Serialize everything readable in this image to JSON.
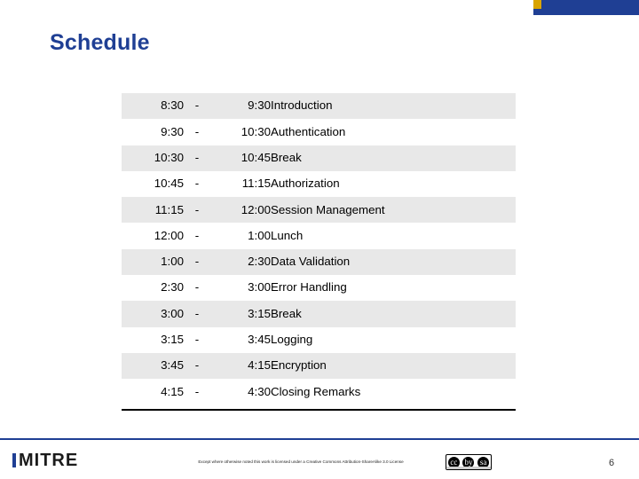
{
  "slide": {
    "title": "Schedule",
    "page_number": "6"
  },
  "decor": {
    "blue_bar_color": "#1f3f94",
    "gold_bar_color": "#d9a400"
  },
  "schedule": {
    "columns": [
      "start",
      "dash",
      "end",
      "description"
    ],
    "rows": [
      {
        "start": "8:30",
        "dash": "-",
        "end": "9:30",
        "description": "Introduction"
      },
      {
        "start": "9:30",
        "dash": "-",
        "end": "10:30",
        "description": "Authentication"
      },
      {
        "start": "10:30",
        "dash": "-",
        "end": "10:45",
        "description": "Break"
      },
      {
        "start": "10:45",
        "dash": "-",
        "end": "11:15",
        "description": "Authorization"
      },
      {
        "start": "11:15",
        "dash": "-",
        "end": "12:00",
        "description": "Session Management"
      },
      {
        "start": "12:00",
        "dash": "-",
        "end": "1:00",
        "description": "Lunch"
      },
      {
        "start": "1:00",
        "dash": "-",
        "end": "2:30",
        "description": "Data Validation"
      },
      {
        "start": "2:30",
        "dash": "-",
        "end": "3:00",
        "description": "Error Handling"
      },
      {
        "start": "3:00",
        "dash": "-",
        "end": "3:15",
        "description": "Break"
      },
      {
        "start": "3:15",
        "dash": "-",
        "end": "3:45",
        "description": "Logging"
      },
      {
        "start": "3:45",
        "dash": "-",
        "end": "4:15",
        "description": "Encryption"
      },
      {
        "start": "4:15",
        "dash": "-",
        "end": "4:30",
        "description": "Closing Remarks"
      }
    ]
  },
  "footer": {
    "logo_text": "MITRE",
    "license_text": "Except where otherwise noted this work is licensed under a Creative Commons Attribution-ShareAlike 3.0 License",
    "cc_badge": {
      "mark": "cc",
      "by": "by",
      "sa": "sa"
    }
  }
}
